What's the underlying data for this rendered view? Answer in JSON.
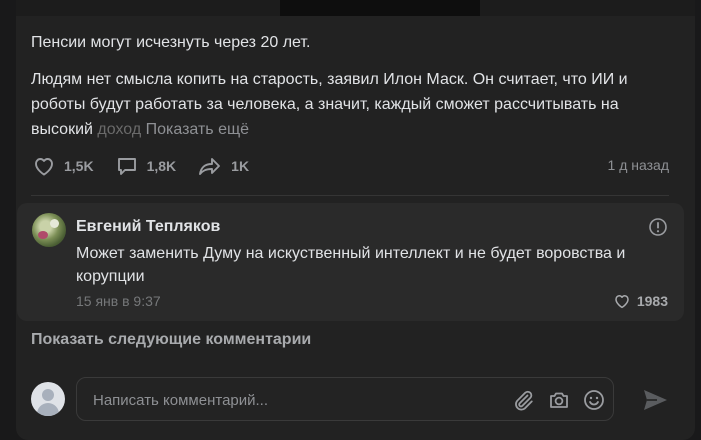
{
  "post": {
    "title": "Пенсии могут исчезнуть через 20 лет.",
    "body_main": "Людям нет смысла копить на старость, заявил Илон Маск. Он считает, что ИИ и роботы будут работать за человека, а значит, каждый сможет рассчитывать на высокий ",
    "body_faded": "доход",
    "show_more_label": "Показать ещё",
    "likes": "1,5K",
    "comments": "1,8K",
    "shares": "1K",
    "date": "1 д назад"
  },
  "comment": {
    "author": "Евгений Тепляков",
    "text": "Может заменить Думу на искуственный интеллект и не будет воровства и корупции",
    "time": "15 янв в 9:37",
    "likes": "1983"
  },
  "next_comments_label": "Показать следующие комментарии",
  "composer": {
    "placeholder": "Написать комментарий..."
  },
  "icons": {
    "like": "heart-icon",
    "comment": "comment-bubble-icon",
    "share": "share-arrow-icon",
    "report": "exclamation-circle-icon",
    "attach": "paperclip-icon",
    "camera": "camera-icon",
    "emoji": "smile-icon",
    "send": "send-icon"
  }
}
